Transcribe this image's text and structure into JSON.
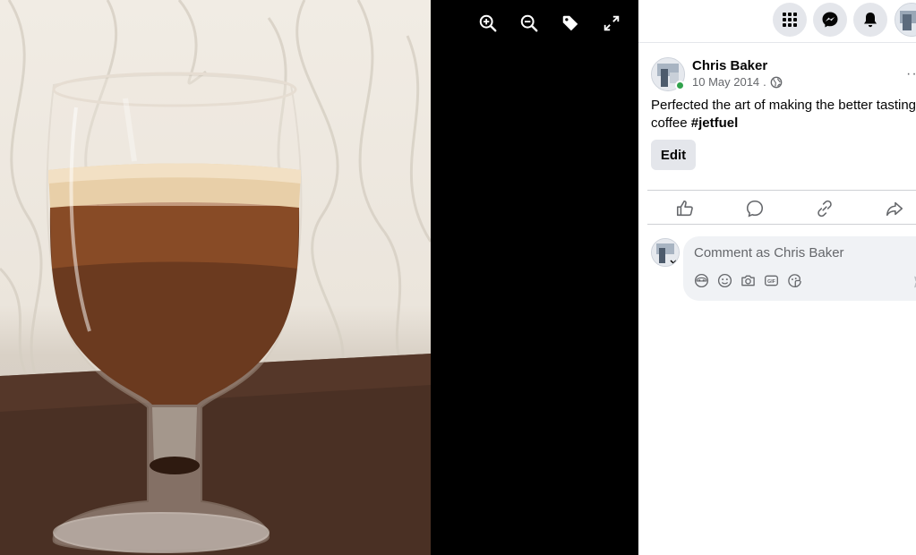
{
  "viewer": {
    "tools": [
      {
        "name": "zoom-in-icon"
      },
      {
        "name": "zoom-out-icon"
      },
      {
        "name": "tag-icon"
      },
      {
        "name": "fullscreen-icon"
      }
    ],
    "photo_description_icon": "photo"
  },
  "topbar": {
    "buttons": [
      {
        "name": "menu-grid-icon"
      },
      {
        "name": "messenger-icon"
      },
      {
        "name": "notifications-bell-icon"
      }
    ]
  },
  "post": {
    "author": "Chris Baker",
    "date": "10 May 2014",
    "date_separator": ".",
    "text": "Perfected the art of making the better tasting coffee ",
    "hashtag": "#jetfuel",
    "edit_label": "Edit",
    "more_label": "···"
  },
  "actions": [
    {
      "name": "like-icon"
    },
    {
      "name": "comment-icon"
    },
    {
      "name": "copy-link-icon"
    },
    {
      "name": "share-icon"
    }
  ],
  "comment": {
    "placeholder": "Comment as Chris Baker",
    "tools": [
      {
        "name": "avatar-sticker-icon"
      },
      {
        "name": "emoji-icon"
      },
      {
        "name": "camera-icon"
      },
      {
        "name": "gif-icon"
      },
      {
        "name": "sticker-icon"
      }
    ]
  },
  "colors": {
    "online": "#31a24c",
    "secondary_text": "#65676b",
    "button_bg": "#e4e6eb",
    "comment_bg": "#f0f2f5"
  }
}
